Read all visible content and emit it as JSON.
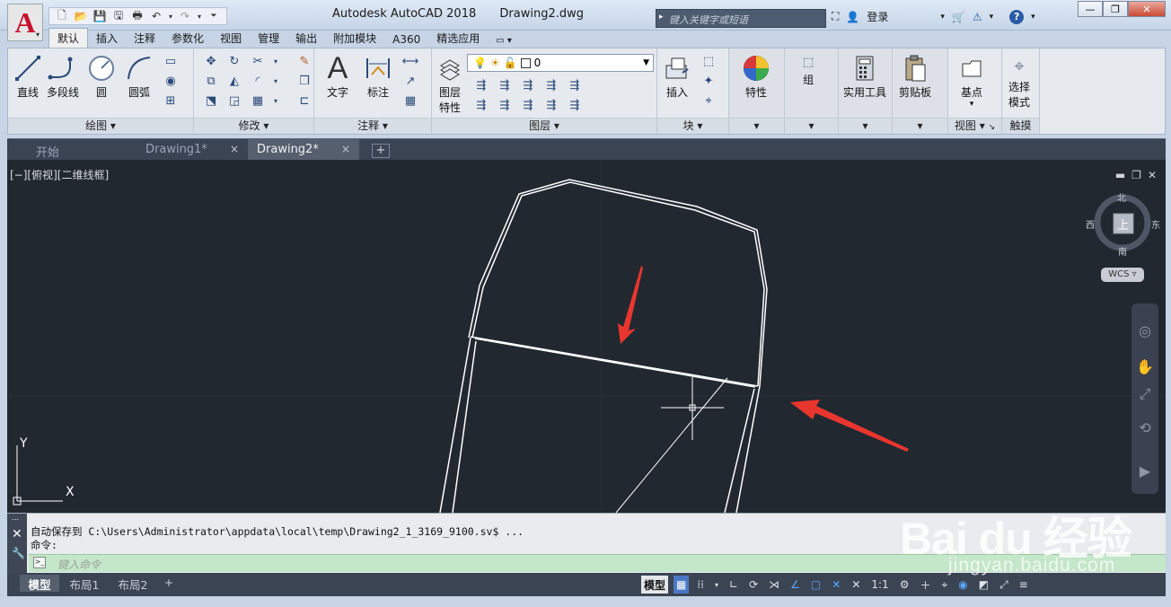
{
  "app": {
    "logo_letter": "A",
    "title": "Autodesk AutoCAD 2018",
    "document": "Drawing2.dwg",
    "search_placeholder": "键入关键字或短语",
    "login_label": "登录",
    "help_label": "?"
  },
  "ribbon_tabs": [
    "默认",
    "插入",
    "注释",
    "参数化",
    "视图",
    "管理",
    "输出",
    "附加模块",
    "A360",
    "精选应用"
  ],
  "ribbon": {
    "draw": {
      "line": "直线",
      "polyline": "多段线",
      "circle": "圆",
      "arc": "圆弧",
      "footer": "绘图 ▾"
    },
    "modify": {
      "footer": "修改 ▾"
    },
    "annotation": {
      "text": "文字",
      "dimension": "标注",
      "footer": "注释 ▾"
    },
    "layers": {
      "props_line1": "图层",
      "props_line2": "特性",
      "current_layer": "0",
      "footer": "图层 ▾"
    },
    "block": {
      "insert": "插入",
      "footer": "块 ▾"
    },
    "properties": {
      "label": "特性"
    },
    "groups": {
      "label": "组"
    },
    "utilities": {
      "label": "实用工具"
    },
    "clipboard": {
      "label": "剪贴板"
    },
    "view": {
      "basepoint": "基点",
      "footer": "视图 ▾"
    },
    "touch": {
      "line1": "选择",
      "line2": "模式",
      "footer": "触摸"
    }
  },
  "file_tabs": [
    {
      "label": "开始"
    },
    {
      "label": "Drawing1*",
      "close": "×"
    },
    {
      "label": "Drawing2*",
      "close": "×"
    }
  ],
  "file_tab_add": "+",
  "viewport": {
    "label": "[−][俯视][二维线框]",
    "cube": {
      "north": "北",
      "south": "南",
      "east": "东",
      "west": "西",
      "face": "上"
    },
    "wcs": "WCS ▿",
    "ucs_x": "X",
    "ucs_y": "Y"
  },
  "command": {
    "history_line1": "自动保存到 C:\\Users\\Administrator\\appdata\\local\\temp\\Drawing2_1_3169_9100.sv$ ...",
    "history_line2": "命令:",
    "input_placeholder": "键入命令"
  },
  "layout_tabs": [
    "模型",
    "布局1",
    "布局2"
  ],
  "status": {
    "model_label": "模型",
    "scale": "1:1"
  },
  "watermark": {
    "logo": "Bai du 经验",
    "url": "jingyan.baidu.com"
  }
}
